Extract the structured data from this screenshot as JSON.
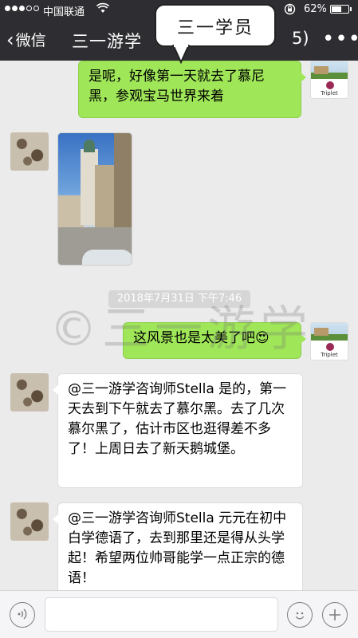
{
  "status_bar": {
    "carrier": "中国联通",
    "battery_percent": "62%",
    "battery_level": 0.62,
    "signal_bars_filled": 3,
    "signal_bars_total": 5,
    "icons": [
      "wifi-icon",
      "orientation-lock-icon",
      "battery-icon"
    ]
  },
  "nav": {
    "back_label": "微信",
    "title": "三一游学",
    "member_count_suffix": "5)",
    "more_label": "•••"
  },
  "overlay": {
    "label": "三一学员"
  },
  "messages": [
    {
      "side": "right",
      "type": "text",
      "text": "是呢，好像第一天就去了慕尼黑，参观宝马世界来着"
    },
    {
      "side": "left",
      "type": "image",
      "description_icon": "photo-thumbnail"
    },
    {
      "side": "right",
      "type": "text",
      "text": "这风景也是太美了吧😍"
    },
    {
      "side": "left",
      "type": "text",
      "text": "@三一游学咨询师Stella 是的，第一天去到下午就去了慕尔黑。去了几次慕尔黑了，估计市区也逛得差不多了！上周日去了新天鹅城堡。"
    },
    {
      "side": "left",
      "type": "text",
      "text": "@三一游学咨询师Stella 元元在初中白学德语了，去到那里还是得从头学起！希望两位帅哥能学一点正宗的德语！"
    }
  ],
  "timestamp": "2018年7月31日 下午7:46",
  "watermark": "©三一游学",
  "right_avatar_logo_text": "Triplet",
  "input_bar": {
    "placeholder": "",
    "voice_icon": "voice-icon",
    "emoji_icon": "emoji-icon",
    "plus_icon": "plus-icon"
  },
  "colors": {
    "nav_bg": "#2e2e32",
    "chat_bg": "#ebebeb",
    "bubble_green": "#9fe658",
    "bubble_white": "#ffffff"
  }
}
